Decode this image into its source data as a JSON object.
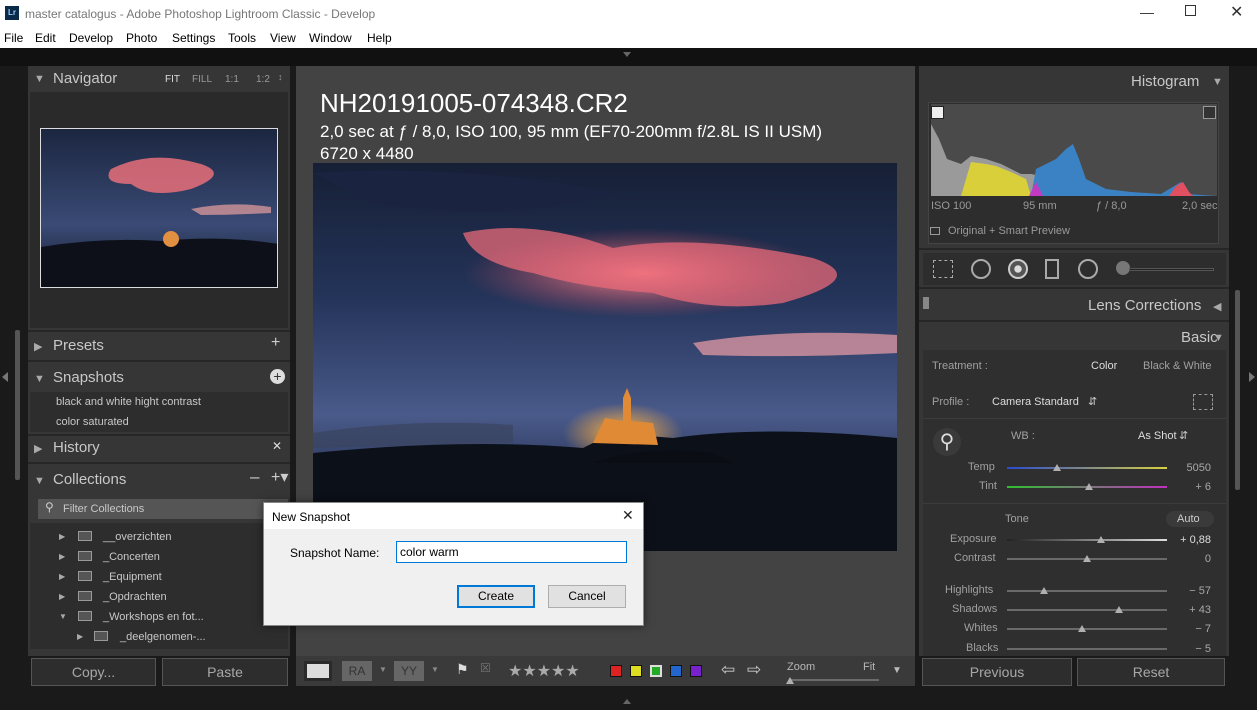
{
  "window": {
    "title": "master catalogus - Adobe Photoshop Lightroom Classic - Develop",
    "app_icon": "Lr"
  },
  "menu": [
    "File",
    "Edit",
    "Develop",
    "Photo",
    "Settings",
    "Tools",
    "View",
    "Window",
    "Help"
  ],
  "navigator": {
    "title": "Navigator",
    "zoom": [
      "FIT",
      "FILL",
      "1:1",
      "1:2"
    ]
  },
  "left": {
    "presets": "Presets",
    "snapshots": {
      "title": "Snapshots",
      "items": [
        "black and white hight contrast",
        "color saturated"
      ]
    },
    "history": "History",
    "collections": {
      "title": "Collections",
      "filter": "Filter Collections",
      "items": [
        "__overzichten",
        "_Concerten",
        "_Equipment",
        "_Opdrachten",
        "_Workshops en fot...",
        "_deelgenomen-..."
      ]
    },
    "copy": "Copy...",
    "paste": "Paste"
  },
  "photo": {
    "filename": "NH20191005-074348.CR2",
    "exposure": "2,0 sec at ƒ / 8,0, ISO 100, 95 mm (EF70-200mm f/2.8L IS II USM)",
    "dimensions": "6720 x 4480"
  },
  "toolbar": {
    "zoom_label": "Zoom",
    "fit_label": "Fit",
    "flag_colors": [
      "#d22",
      "#dd2",
      "#2a2",
      "#26c",
      "#72c"
    ]
  },
  "histogram": {
    "title": "Histogram",
    "iso": "ISO 100",
    "focal": "95 mm",
    "aperture": "ƒ / 8,0",
    "shutter": "2,0 sec",
    "preview": "Original + Smart Preview"
  },
  "lens": "Lens Corrections",
  "basic": {
    "title": "Basic",
    "treatment_label": "Treatment :",
    "color": "Color",
    "bw": "Black & White",
    "profile_label": "Profile :",
    "profile": "Camera Standard",
    "wb_label": "WB :",
    "wb": "As Shot",
    "temp_label": "Temp",
    "temp": "5050",
    "tint_label": "Tint",
    "tint": "+ 6",
    "tone": "Tone",
    "auto": "Auto",
    "exposure_label": "Exposure",
    "exposure": "+ 0,88",
    "contrast_label": "Contrast",
    "contrast": "0",
    "highlights_label": "Highlights",
    "highlights": "− 57",
    "shadows_label": "Shadows",
    "shadows": "+ 43",
    "whites_label": "Whites",
    "whites": "− 7",
    "blacks_label": "Blacks",
    "blacks": "− 5"
  },
  "previous": "Previous",
  "reset": "Reset",
  "dialog": {
    "title": "New Snapshot",
    "name_label": "Snapshot Name:",
    "name_value": "color warm",
    "create": "Create",
    "cancel": "Cancel"
  }
}
